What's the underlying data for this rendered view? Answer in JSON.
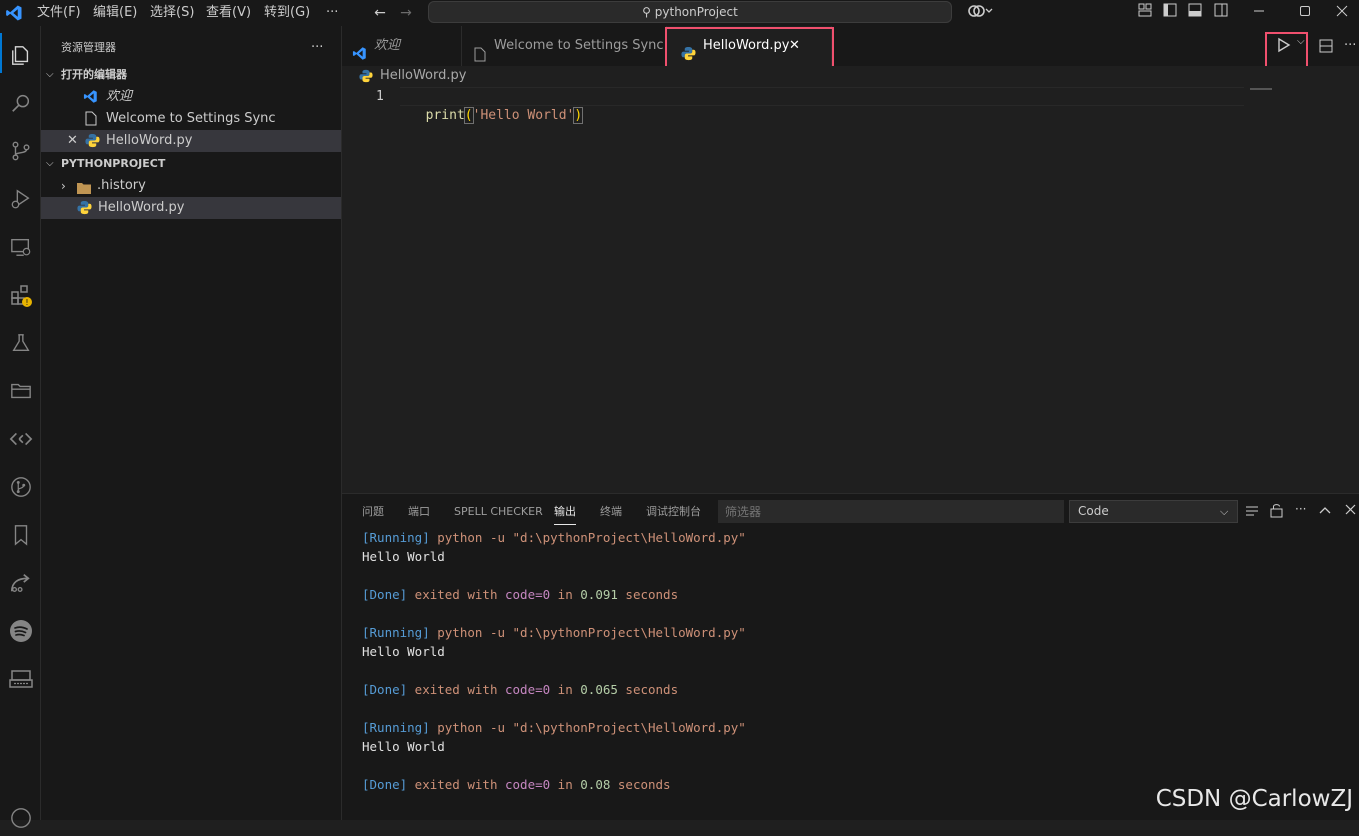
{
  "menu": {
    "file": "文件(F)",
    "edit": "编辑(E)",
    "select": "选择(S)",
    "view": "查看(V)",
    "goto": "转到(G)",
    "more": "···"
  },
  "search": {
    "text": "pythonProject"
  },
  "sidebar": {
    "title": "资源管理器",
    "more": "···",
    "open_editors_header": "打开的编辑器",
    "open_editors": [
      {
        "label": "欢迎"
      },
      {
        "label": "Welcome to Settings Sync"
      },
      {
        "label": "HelloWord.py"
      }
    ],
    "project_header": "PYTHONPROJECT",
    "tree": [
      {
        "label": ".history"
      },
      {
        "label": "HelloWord.py"
      }
    ]
  },
  "tabs": [
    {
      "label": "欢迎"
    },
    {
      "label": "Welcome to Settings Sync"
    },
    {
      "label": "HelloWord.py"
    }
  ],
  "editor": {
    "breadcrumb": "HelloWord.py",
    "line_number": "1",
    "code_func": "print",
    "code_paren_open": "(",
    "code_string": "'Hello World'",
    "code_paren_close": ")"
  },
  "panel": {
    "tabs": [
      "问题",
      "端口",
      "SPELL CHECKER",
      "输出",
      "终端",
      "调试控制台"
    ],
    "filter_placeholder": "筛选器",
    "channel": "Code",
    "output": [
      {
        "kind": "run",
        "tag": "[Running]",
        "cmd": " python -u \"d:\\pythonProject\\HelloWord.py\""
      },
      {
        "kind": "text",
        "text": "Hello World"
      },
      {
        "kind": "blank"
      },
      {
        "kind": "done",
        "tag": "[Done]",
        "pre": " exited with ",
        "code": "code=0",
        "mid": " in ",
        "num": "0.091",
        "post": " seconds"
      },
      {
        "kind": "blank"
      },
      {
        "kind": "run",
        "tag": "[Running]",
        "cmd": " python -u \"d:\\pythonProject\\HelloWord.py\""
      },
      {
        "kind": "text",
        "text": "Hello World"
      },
      {
        "kind": "blank"
      },
      {
        "kind": "done",
        "tag": "[Done]",
        "pre": " exited with ",
        "code": "code=0",
        "mid": " in ",
        "num": "0.065",
        "post": " seconds"
      },
      {
        "kind": "blank"
      },
      {
        "kind": "run",
        "tag": "[Running]",
        "cmd": " python -u \"d:\\pythonProject\\HelloWord.py\""
      },
      {
        "kind": "text",
        "text": "Hello World"
      },
      {
        "kind": "blank"
      },
      {
        "kind": "done",
        "tag": "[Done]",
        "pre": " exited with ",
        "code": "code=0",
        "mid": " in ",
        "num": "0.08",
        "post": " seconds"
      }
    ]
  },
  "watermark": "CSDN @CarlowZJ",
  "colors": {
    "accent_red": "#f0506e",
    "vscode_blue": "#0078d4"
  }
}
